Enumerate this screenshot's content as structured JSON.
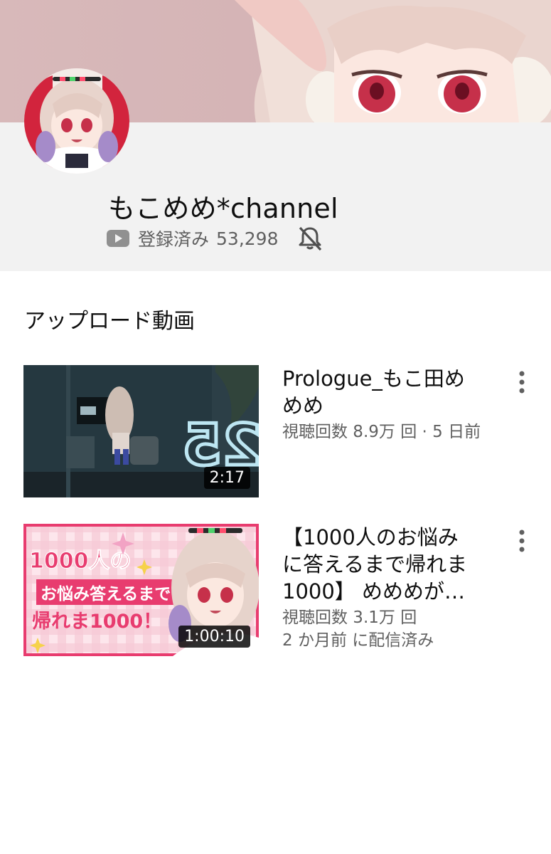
{
  "channel": {
    "name": "もこめめ*channel",
    "subscriber_label": "登録済み",
    "subscriber_count": "53,298"
  },
  "section": {
    "title": "アップロード動画"
  },
  "videos": [
    {
      "title_line1": "Prologue_もこ田め",
      "title_line2": "めめ",
      "title_line3": "",
      "meta_line1": "視聴回数 8.9万 回 · 5 日前",
      "meta_line2": "",
      "duration": "2:17",
      "thumb_text": "25"
    },
    {
      "title_line1": "【1000人のお悩み",
      "title_line2": "に答えるまで帰れま",
      "title_line3": "1000】 めめめが…",
      "meta_line1": "視聴回数 3.1万 回",
      "meta_line2": "2 か月前 に配信済み",
      "duration": "1:00:10",
      "thumb_text_1": "1000人の",
      "thumb_text_2": "お悩み答えるまで",
      "thumb_text_3": "帰れま1000！"
    }
  ],
  "icons": {
    "youtube": "youtube-icon",
    "bell_off": "bell-off-icon",
    "more": "more-vert-icon"
  },
  "colors": {
    "banner": "#d6b7b8",
    "header_bg": "#f2f2f2",
    "secondary_text": "#606060",
    "thumb2_accent": "#e83c6f"
  }
}
